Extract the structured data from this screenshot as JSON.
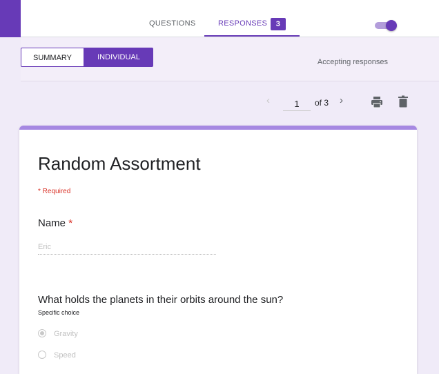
{
  "tabs": {
    "questions_label": "QUESTIONS",
    "responses_label": "RESPONSES",
    "responses_count": "3"
  },
  "view_toggle": {
    "summary_label": "SUMMARY",
    "individual_label": "INDIVIDUAL",
    "selected": "INDIVIDUAL"
  },
  "accepting": {
    "label": "Accepting responses",
    "enabled": true
  },
  "pager": {
    "current_page": "1",
    "of_text": "of 3",
    "prev_icon": "chevron-left-icon",
    "next_icon": "chevron-right-icon",
    "print_icon": "print-icon",
    "delete_icon": "trash-icon"
  },
  "form": {
    "title": "Random Assortment",
    "required_note": "* Required",
    "questions": [
      {
        "title": "Name",
        "required_marker": "*",
        "answer": "Eric"
      },
      {
        "title": "What holds the planets in their orbits around the sun?",
        "description": "Specific choice",
        "options": [
          {
            "label": "Gravity",
            "selected": true
          },
          {
            "label": "Speed",
            "selected": false
          }
        ]
      }
    ]
  },
  "colors": {
    "accent": "#673ab7",
    "accent_light": "#a688e2",
    "background": "#f0ebf8",
    "required": "#d93025"
  }
}
